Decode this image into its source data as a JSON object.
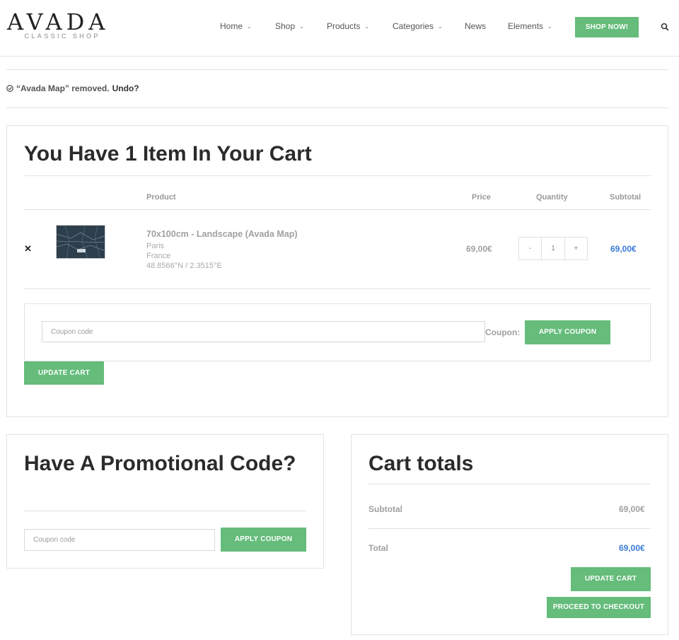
{
  "header": {
    "logo_main": "AVADA",
    "logo_sub": "CLASSIC SHOP",
    "nav": [
      {
        "label": "Home",
        "has_menu": true
      },
      {
        "label": "Shop",
        "has_menu": true
      },
      {
        "label": "Products",
        "has_menu": true
      },
      {
        "label": "Categories",
        "has_menu": true
      },
      {
        "label": "News",
        "has_menu": false
      },
      {
        "label": "Elements",
        "has_menu": true
      }
    ],
    "cta_label": "SHOP NOW!",
    "search_icon": "search-icon"
  },
  "notice": {
    "icon": "check-circle-icon",
    "text": "“Avada Map” removed.",
    "undo_label": "Undo?"
  },
  "cart": {
    "title": "You Have 1 Item In Your Cart",
    "columns": {
      "product": "Product",
      "price": "Price",
      "quantity": "Quantity",
      "subtotal": "Subtotal"
    },
    "items": [
      {
        "remove_icon": "close-icon",
        "name": "70x100cm - Landscape (Avada Map)",
        "city": "Paris",
        "country": "France",
        "coords": "48.8566°N / 2.3515°E",
        "price": "69,00€",
        "qty_minus": "-",
        "quantity": "1",
        "qty_plus": "+",
        "subtotal": "69,00€"
      }
    ],
    "coupon_placeholder": "Coupon code",
    "coupon_label": "Coupon:",
    "apply_label": "APPLY COUPON",
    "update_label": "UPDATE CART"
  },
  "promo": {
    "title": "Have A Promotional Code?",
    "coupon_placeholder": "Coupon code",
    "apply_label": "APPLY COUPON"
  },
  "totals": {
    "title": "Cart totals",
    "subtotal_label": "Subtotal",
    "subtotal_value": "69,00€",
    "total_label": "Total",
    "total_value": "69,00€",
    "update_label": "UPDATE CART",
    "checkout_label": "PROCEED TO CHECKOUT"
  },
  "colors": {
    "accent_green": "#65bc7b",
    "link_blue": "#3a7bd5"
  }
}
